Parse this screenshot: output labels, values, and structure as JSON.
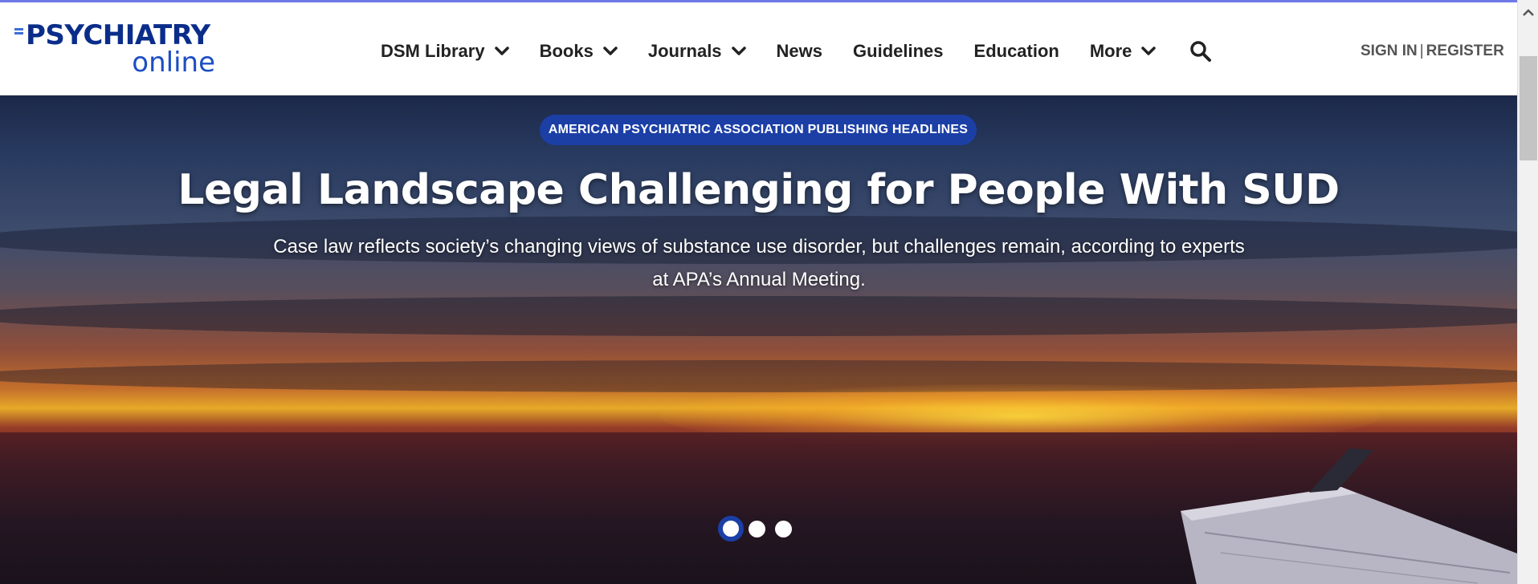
{
  "header": {
    "logo": {
      "line1": "PSYCHIATRY",
      "line2": "online",
      "icon": "logo-mark"
    },
    "nav": [
      {
        "label": "DSM Library",
        "has_dropdown": true
      },
      {
        "label": "Books",
        "has_dropdown": true
      },
      {
        "label": "Journals",
        "has_dropdown": true
      },
      {
        "label": "News",
        "has_dropdown": false
      },
      {
        "label": "Guidelines",
        "has_dropdown": false
      },
      {
        "label": "Education",
        "has_dropdown": false
      },
      {
        "label": "More",
        "has_dropdown": true
      }
    ],
    "search_icon": "search-icon",
    "auth": {
      "sign_in": "SIGN IN",
      "separator": "|",
      "register": "REGISTER"
    }
  },
  "hero": {
    "badge": "AMERICAN PSYCHIATRIC ASSOCIATION PUBLISHING HEADLINES",
    "headline": "Legal Landscape Challenging for People With SUD",
    "subhead_line1": "Case law reflects society’s changing views of substance use disorder, but challenges remain, according to experts",
    "subhead_line2": "at APA’s Annual Meeting.",
    "carousel": {
      "slide_count": 3,
      "active_index": 0
    }
  },
  "colors": {
    "brand_dark": "#0b2d8a",
    "brand": "#1d4ec2",
    "badge_bg": "#1c3fa6",
    "nav_text": "#222222",
    "auth_text": "#555555"
  }
}
